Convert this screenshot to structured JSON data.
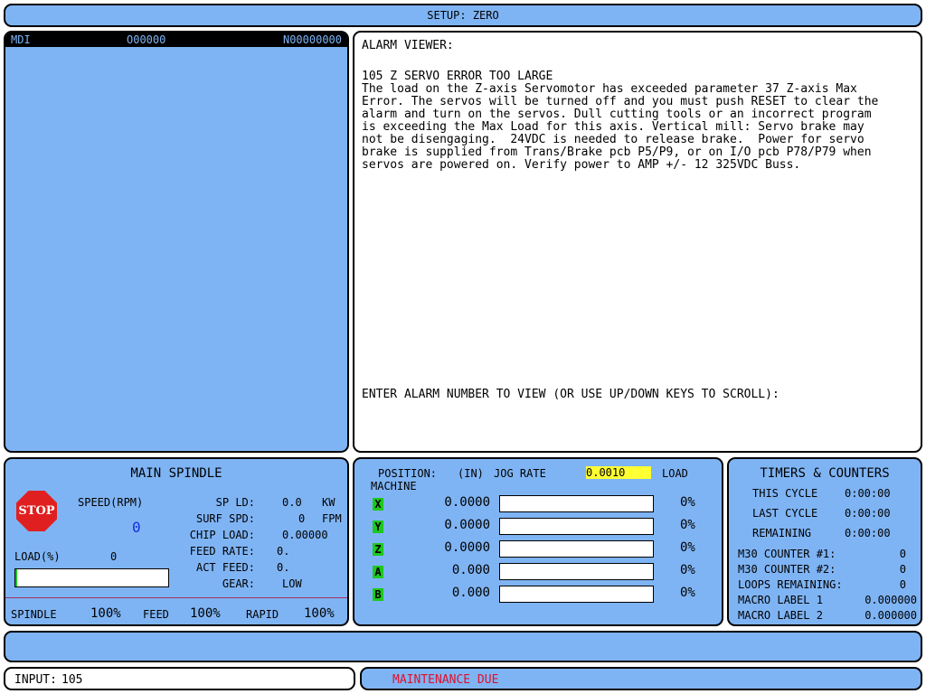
{
  "title": "SETUP: ZERO",
  "program": {
    "mode": "MDI",
    "program_number": "O00000",
    "sequence_number": "N00000000"
  },
  "alarm": {
    "header": "ALARM VIEWER:",
    "body": "105 Z SERVO ERROR TOO LARGE\nThe load on the Z-axis Servomotor has exceeded parameter 37 Z-axis Max\nError. The servos will be turned off and you must push RESET to clear the\nalarm and turn on the servos. Dull cutting tools or an incorrect program\nis exceeding the Max Load for this axis. Vertical mill: Servo brake may\nnot be disengaging.  24VDC is needed to release brake.  Power for servo\nbrake is supplied from Trans/Brake pcb P5/P9, or on I/O pcb P78/P79 when\nservos are powered on. Verify power to AMP +/- 12 325VDC Buss.",
    "prompt": "ENTER ALARM NUMBER TO VIEW (OR USE UP/DOWN KEYS TO SCROLL):"
  },
  "spindle": {
    "title": "MAIN SPINDLE",
    "stop_label": "STOP",
    "speed_label": "SPEED(RPM)",
    "speed_value": "0",
    "load_label": "LOAD(%)",
    "load_value": "0",
    "load_fraction": 0,
    "sp_ld_label": "SP LD:",
    "sp_ld_value": "0.0",
    "sp_ld_unit": "KW",
    "surf_spd_label": "SURF SPD:",
    "surf_spd_value": "0",
    "surf_spd_unit": "FPM",
    "chip_load_label": "CHIP LOAD:",
    "chip_load_value": "0.00000",
    "feed_rate_label": "FEED RATE:",
    "feed_rate_value": "0.",
    "act_feed_label": "ACT FEED:",
    "act_feed_value": "0.",
    "gear_label": "GEAR:",
    "gear_value": "LOW",
    "override_spindle_label": "SPINDLE",
    "override_spindle_value": "100%",
    "override_feed_label": "FEED",
    "override_feed_value": "100%",
    "override_rapid_label": "RAPID",
    "override_rapid_value": "100%"
  },
  "position": {
    "position_label": "POSITION:",
    "units_label": "(IN)",
    "jog_rate_label": "JOG RATE",
    "jog_rate_value": "0.0010",
    "load_label": "LOAD",
    "machine_label": "MACHINE",
    "axes": [
      {
        "name": "X",
        "value": "0.0000",
        "load": "0%",
        "load_fraction": 0
      },
      {
        "name": "Y",
        "value": "0.0000",
        "load": "0%",
        "load_fraction": 0
      },
      {
        "name": "Z",
        "value": "0.0000",
        "load": "0%",
        "load_fraction": 0
      },
      {
        "name": "A",
        "value": "0.000",
        "load": "0%",
        "load_fraction": 0
      },
      {
        "name": "B",
        "value": "0.000",
        "load": "0%",
        "load_fraction": 0
      }
    ]
  },
  "timers": {
    "title": "TIMERS & COUNTERS",
    "this_cycle_label": "THIS CYCLE",
    "this_cycle_value": "0:00:00",
    "last_cycle_label": "LAST CYCLE",
    "last_cycle_value": "0:00:00",
    "remaining_label": "REMAINING",
    "remaining_value": "0:00:00",
    "m30_1_label": "M30 COUNTER #1:",
    "m30_1_value": "0",
    "m30_2_label": "M30 COUNTER #2:",
    "m30_2_value": "0",
    "loops_label": "LOOPS REMAINING:",
    "loops_value": "0",
    "macro1_label": "MACRO LABEL 1",
    "macro1_value": "0.000000",
    "macro2_label": "MACRO LABEL 2",
    "macro2_value": "0.000000"
  },
  "input": {
    "label": "INPUT:",
    "value": "105"
  },
  "status": {
    "message": "MAINTENANCE DUE",
    "color": "#e0102a"
  },
  "colors": {
    "panel": "#7fb4f4",
    "jog_highlight": "#ffff33",
    "speed_value": "#1030e0",
    "axis_marker": "#1ec81e",
    "stop_sign": "#e02020"
  }
}
